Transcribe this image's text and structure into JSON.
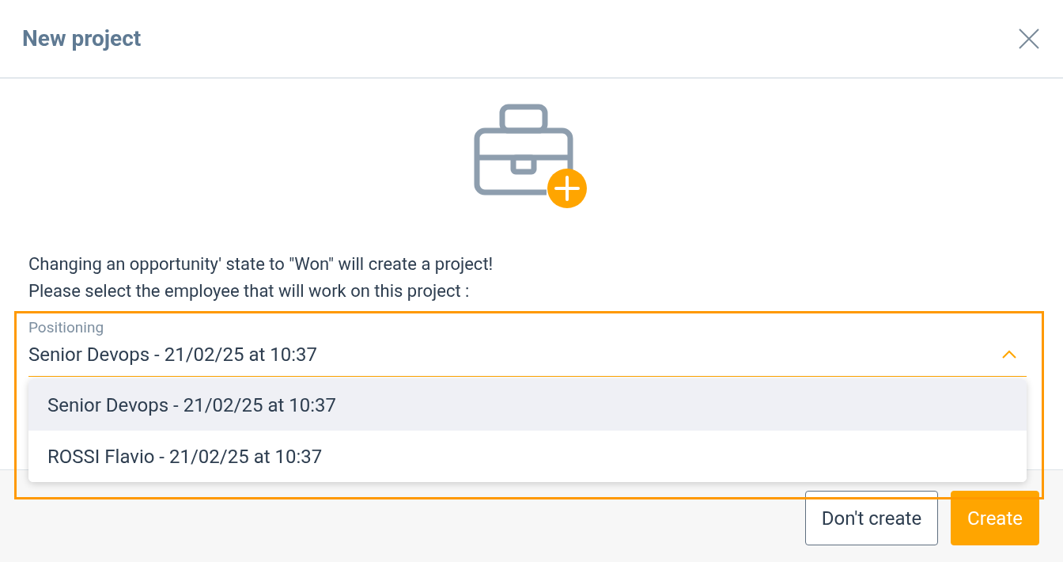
{
  "dialog": {
    "title": "New project"
  },
  "message": [
    "Changing an opportunity' state to \"Won\" will create a project!",
    "Please select the employee that will work on this project :"
  ],
  "field": {
    "label": "Positioning",
    "value": "Senior Devops - 21/02/25 at 10:37",
    "expanded": true,
    "highlighted": true
  },
  "options": [
    {
      "label": "Senior Devops - 21/02/25 at 10:37",
      "selected": true
    },
    {
      "label": "ROSSI Flavio - 21/02/25 at 10:37",
      "selected": false
    }
  ],
  "buttons": [
    {
      "label": "Don't create",
      "kind": "secondary"
    },
    {
      "label": "Create",
      "kind": "primary"
    }
  ]
}
